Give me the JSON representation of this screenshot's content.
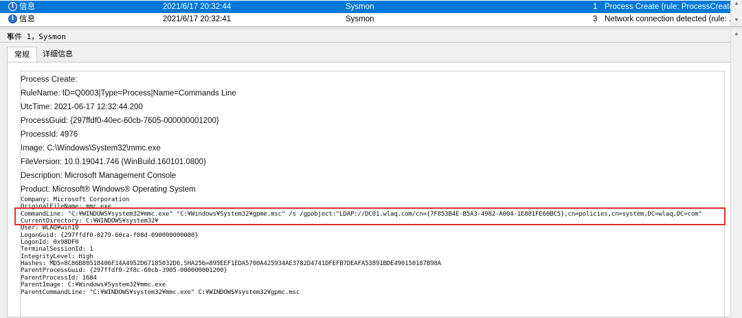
{
  "event_list": {
    "rows": [
      {
        "level": "信息",
        "datetime": "2021/6/17 20:32:44",
        "source": "Sysmon",
        "event_id": "1",
        "task": "Process Create (rule: ProcessCreate)",
        "selected": true
      },
      {
        "level": "信息",
        "datetime": "2021/6/17 20:32:41",
        "source": "Sysmon",
        "event_id": "3",
        "task": "Network connection detected (rule: ...",
        "selected": false
      }
    ]
  },
  "event_detail": {
    "title": "事件 1，Sysmon",
    "close_glyph": "×",
    "tabs": [
      "常规",
      "详细信息"
    ],
    "proportional_lines": [
      "Process Create:",
      "RuleName: ID=Q0003|Type=Process|Name=Commands Line",
      "UtcTime: 2021-06-17 12:32:44.200",
      "ProcessGuid: {297ffdf0-40ec-60cb-7605-000000001200}",
      "ProcessId: 4976",
      "Image: C:\\Windows\\System32\\mmc.exe",
      "FileVersion: 10.0.19041.746 (WinBuild.160101.0800)",
      "Description: Microsoft Management Console",
      "Product: Microsoft® Windows® Operating System"
    ],
    "mono_lines": [
      "Company: Microsoft Corporation",
      "OriginalFileName: mmc.exe",
      "CommandLine: \"C:¥WINDOWS¥system32¥mmc.exe\" \"C:¥Windows¥System32¥gpme.msc\" /s /gpobject:\"LDAP://DC01.wlaq.com/cn={7F853B4E-B5A3-4982-A004-1E881FE60BC5},cn=policies,cn=system,DC=wlaq,DC=com\"",
      "CurrentDirectory: C:¥WINDOWS¥system32¥",
      "User: WLAQ¥win10",
      "LogonGuid: {297ffdf0-0279-60ca-f08d-090000000000}",
      "LogonId: 0x98DF0",
      "TerminalSessionId: 1",
      "IntegrityLevel: High",
      "Hashes: MD5=8C86B80518406F14A4952D67185032D6,SHA256=895EEF1EDA5700A425934AE3782D4741DFEFB7DEAFA53891BDE490150187B98A",
      "ParentProcessGuid: {297ffdf0-2f8c-60cb-3905-000000001200}",
      "ParentProcessId: 1684",
      "ParentImage: C:¥Windows¥System32¥mmc.exe",
      "ParentCommandLine: \"C:¥WINDOWS¥system32¥mmc.exe\" C:¥WINDOWS¥system32¥gpmc.msc"
    ]
  },
  "colors": {
    "selection": "#0078d7",
    "highlight_border": "#e0302a"
  },
  "icons": {
    "level_icon": "info-icon"
  }
}
